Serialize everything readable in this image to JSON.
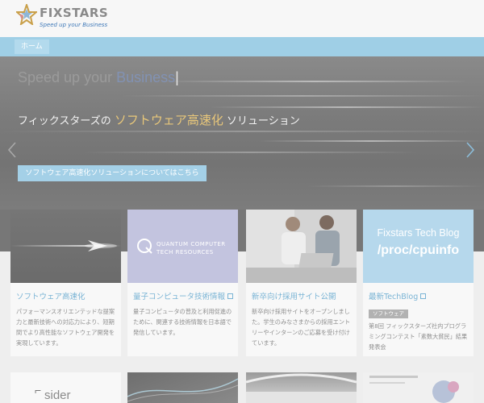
{
  "header": {
    "logo_word": "FIXSTARS",
    "logo_tagline": "Speed up your Business"
  },
  "nav": {
    "items": [
      {
        "label": "ホーム"
      }
    ]
  },
  "hero": {
    "title_main": "Speed up your ",
    "title_accent": "Business",
    "title_cursor": "|",
    "subtitle_pre": "フィックスターズの ",
    "subtitle_highlight": "ソフトウェア高速化",
    "subtitle_post": " ソリューション",
    "cta_label": "ソフトウェア高速化ソリューションについてはこちら"
  },
  "cards": [
    {
      "title": "ソフトウェア高速化",
      "external": false,
      "description": "パフォーマンスオリエンテッドな提案力と最新技術への対応力により、短期間でより高性能なソフトウェア開発を実現しています。"
    },
    {
      "title": "量子コンピュータ技術情報",
      "external": true,
      "image_text_1": "QUANTUM COMPUTER",
      "image_text_2": "TECH RESOURCES",
      "description": "量子コンピュータの普及と利用促進のために、関連する技術情報を日本語で発信しています。"
    },
    {
      "title": "新卒向け採用サイト公開",
      "external": false,
      "description": "新卒向け採用サイトをオープンしました。学生のみなさまからの採用エントリーやインターンのご応募を受け付けています。"
    },
    {
      "title": "最新TechBlog",
      "external": true,
      "image_text_1": "Fixstars Tech Blog",
      "image_text_2": "/proc/cpuinfo",
      "badge": "ソフトウェア",
      "description": "第8回 フィックスターズ社内プログラミングコンテスト「素数大貧民」結果発表会"
    }
  ],
  "bottom_cards": [
    {
      "label": "sider"
    }
  ],
  "colors": {
    "nav_bar": "#9fcfe6",
    "link": "#7ab4d5",
    "hero_highlight": "#e8c77a"
  }
}
